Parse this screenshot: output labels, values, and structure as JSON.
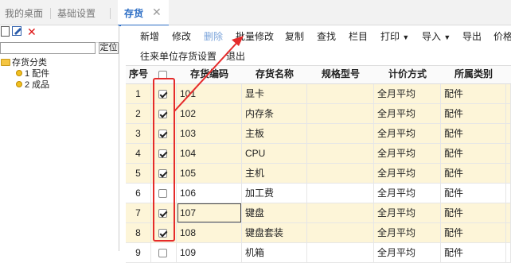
{
  "tabs": [
    {
      "label": "我的桌面",
      "active": false
    },
    {
      "label": "基础设置",
      "active": false
    },
    {
      "label": "存货",
      "active": true
    }
  ],
  "tab_close_icon": "close-icon",
  "left_toolbar": [
    "new-doc-icon",
    "edit-icon",
    "delete-icon"
  ],
  "left_search": {
    "value": "",
    "locate_label": "定位"
  },
  "tree": {
    "root": "存货分类",
    "children": [
      "1 配件",
      "2 成品"
    ]
  },
  "toolbar": {
    "items": [
      {
        "label": "新增",
        "disabled": false
      },
      {
        "label": "修改",
        "disabled": false
      },
      {
        "label": "删除",
        "disabled": true
      },
      {
        "label": "批量修改",
        "disabled": false
      },
      {
        "label": "复制",
        "disabled": false
      },
      {
        "label": "查找",
        "disabled": false
      },
      {
        "label": "栏目",
        "disabled": false
      },
      {
        "label": "打印",
        "dropdown": true
      },
      {
        "label": "导入",
        "dropdown": true
      },
      {
        "label": "导出",
        "disabled": false
      },
      {
        "label": "价格",
        "disabled": false
      }
    ],
    "row2": [
      "往来单位存货设置",
      "退出"
    ]
  },
  "table": {
    "columns": [
      "序号",
      "",
      "存货编码",
      "存货名称",
      "规格型号",
      "计价方式",
      "所属类别"
    ],
    "rows": [
      {
        "no": "1",
        "checked": true,
        "code": "101",
        "name": "显卡",
        "spec": "",
        "method": "全月平均",
        "category": "配件"
      },
      {
        "no": "2",
        "checked": true,
        "code": "102",
        "name": "内存条",
        "spec": "",
        "method": "全月平均",
        "category": "配件"
      },
      {
        "no": "3",
        "checked": true,
        "code": "103",
        "name": "主板",
        "spec": "",
        "method": "全月平均",
        "category": "配件"
      },
      {
        "no": "4",
        "checked": true,
        "code": "104",
        "name": "CPU",
        "spec": "",
        "method": "全月平均",
        "category": "配件"
      },
      {
        "no": "5",
        "checked": true,
        "code": "105",
        "name": "主机",
        "spec": "",
        "method": "全月平均",
        "category": "配件"
      },
      {
        "no": "6",
        "checked": false,
        "code": "106",
        "name": "加工费",
        "spec": "",
        "method": "全月平均",
        "category": "配件"
      },
      {
        "no": "7",
        "checked": true,
        "code": "107",
        "name": "键盘",
        "spec": "",
        "method": "全月平均",
        "category": "配件"
      },
      {
        "no": "8",
        "checked": true,
        "code": "108",
        "name": "键盘套装",
        "spec": "",
        "method": "全月平均",
        "category": "配件"
      },
      {
        "no": "9",
        "checked": false,
        "code": "109",
        "name": "机箱",
        "spec": "",
        "method": "全月平均",
        "category": "配件"
      }
    ]
  },
  "annotation": {
    "color": "#e52b2b"
  }
}
